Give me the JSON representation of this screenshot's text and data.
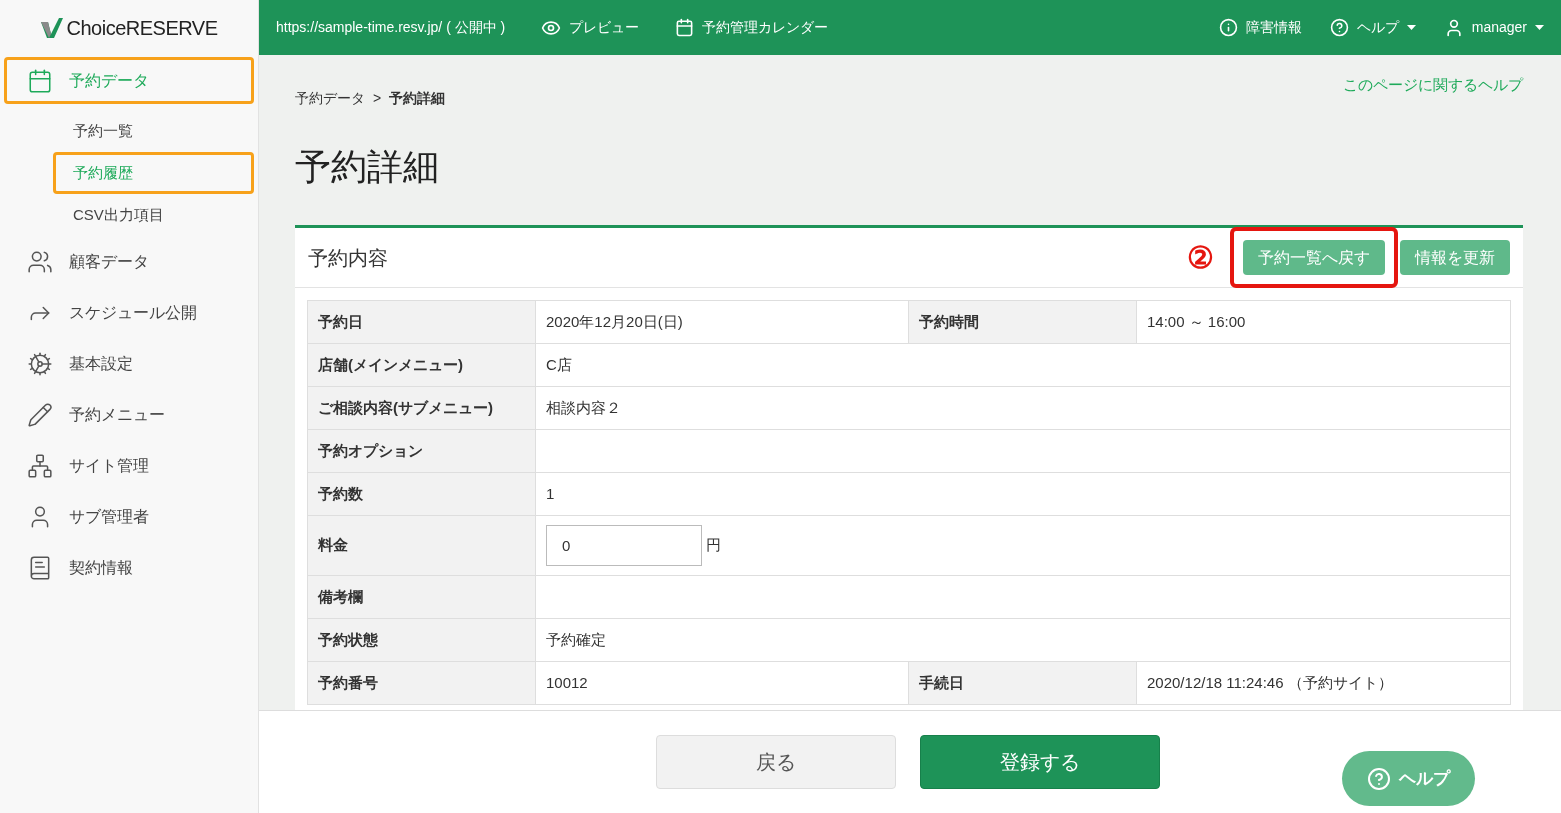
{
  "logo": {
    "text": "ChoiceRESERVE"
  },
  "topbar": {
    "url": "https://sample-time.resv.jp/ ( 公開中 )",
    "links": [
      "プレビュー",
      "予約管理カレンダー"
    ],
    "right": [
      {
        "label": "障害情報",
        "dropdown": false
      },
      {
        "label": "ヘルプ",
        "dropdown": true
      },
      {
        "label": "manager",
        "dropdown": true
      }
    ]
  },
  "sidebar": {
    "items": [
      {
        "label": "予約データ",
        "selected": true,
        "highlighted": true,
        "children": [
          {
            "label": "予約一覧",
            "selected": false,
            "highlighted": false
          },
          {
            "label": "予約履歴",
            "selected": true,
            "highlighted": true
          },
          {
            "label": "CSV出力項目",
            "selected": false,
            "highlighted": false
          }
        ]
      },
      {
        "label": "顧客データ",
        "selected": false,
        "highlighted": false
      },
      {
        "label": "スケジュール公開",
        "selected": false,
        "highlighted": false
      },
      {
        "label": "基本設定",
        "selected": false,
        "highlighted": false
      },
      {
        "label": "予約メニュー",
        "selected": false,
        "highlighted": false
      },
      {
        "label": "サイト管理",
        "selected": false,
        "highlighted": false
      },
      {
        "label": "サブ管理者",
        "selected": false,
        "highlighted": false
      },
      {
        "label": "契約情報",
        "selected": false,
        "highlighted": false
      }
    ]
  },
  "page_help_link": "このページに関するヘルプ",
  "breadcrumb": [
    "予約データ",
    "予約詳細"
  ],
  "breadcrumb_separator": ">",
  "title": "予約詳細",
  "card": {
    "title": "予約内容",
    "annotation": "②",
    "buttons": [
      {
        "label": "予約一覧へ戻す",
        "highlighted": true
      },
      {
        "label": "情報を更新",
        "highlighted": false
      }
    ],
    "rows": [
      {
        "kind": "pair",
        "label": "予約日",
        "value": "2020年12月20日(日)",
        "label2": "予約時間",
        "value2": "14:00 ～ 16:00"
      },
      {
        "kind": "text",
        "label": "店舗(メインメニュー)",
        "value": "C店"
      },
      {
        "kind": "text",
        "label": "ご相談内容(サブメニュー)",
        "value": "相談内容２"
      },
      {
        "kind": "text",
        "label": "予約オプション"
      },
      {
        "kind": "text",
        "label": "予約数",
        "value": "1"
      },
      {
        "kind": "field",
        "label": "料金",
        "value": "0",
        "unit": "円"
      },
      {
        "kind": "text",
        "label": "備考欄"
      },
      {
        "kind": "text",
        "label": "予約状態",
        "value": "予約確定"
      },
      {
        "kind": "pair",
        "label": "予約番号",
        "value": "10012",
        "label2": "手続日",
        "value2": "2020/12/18 11:24:46 （予約サイト）"
      }
    ]
  },
  "footer": {
    "buttons": [
      {
        "label": "戻る",
        "kind": "secondary"
      },
      {
        "label": "登録する",
        "kind": "primary"
      }
    ],
    "help_button": "ヘルプ"
  }
}
